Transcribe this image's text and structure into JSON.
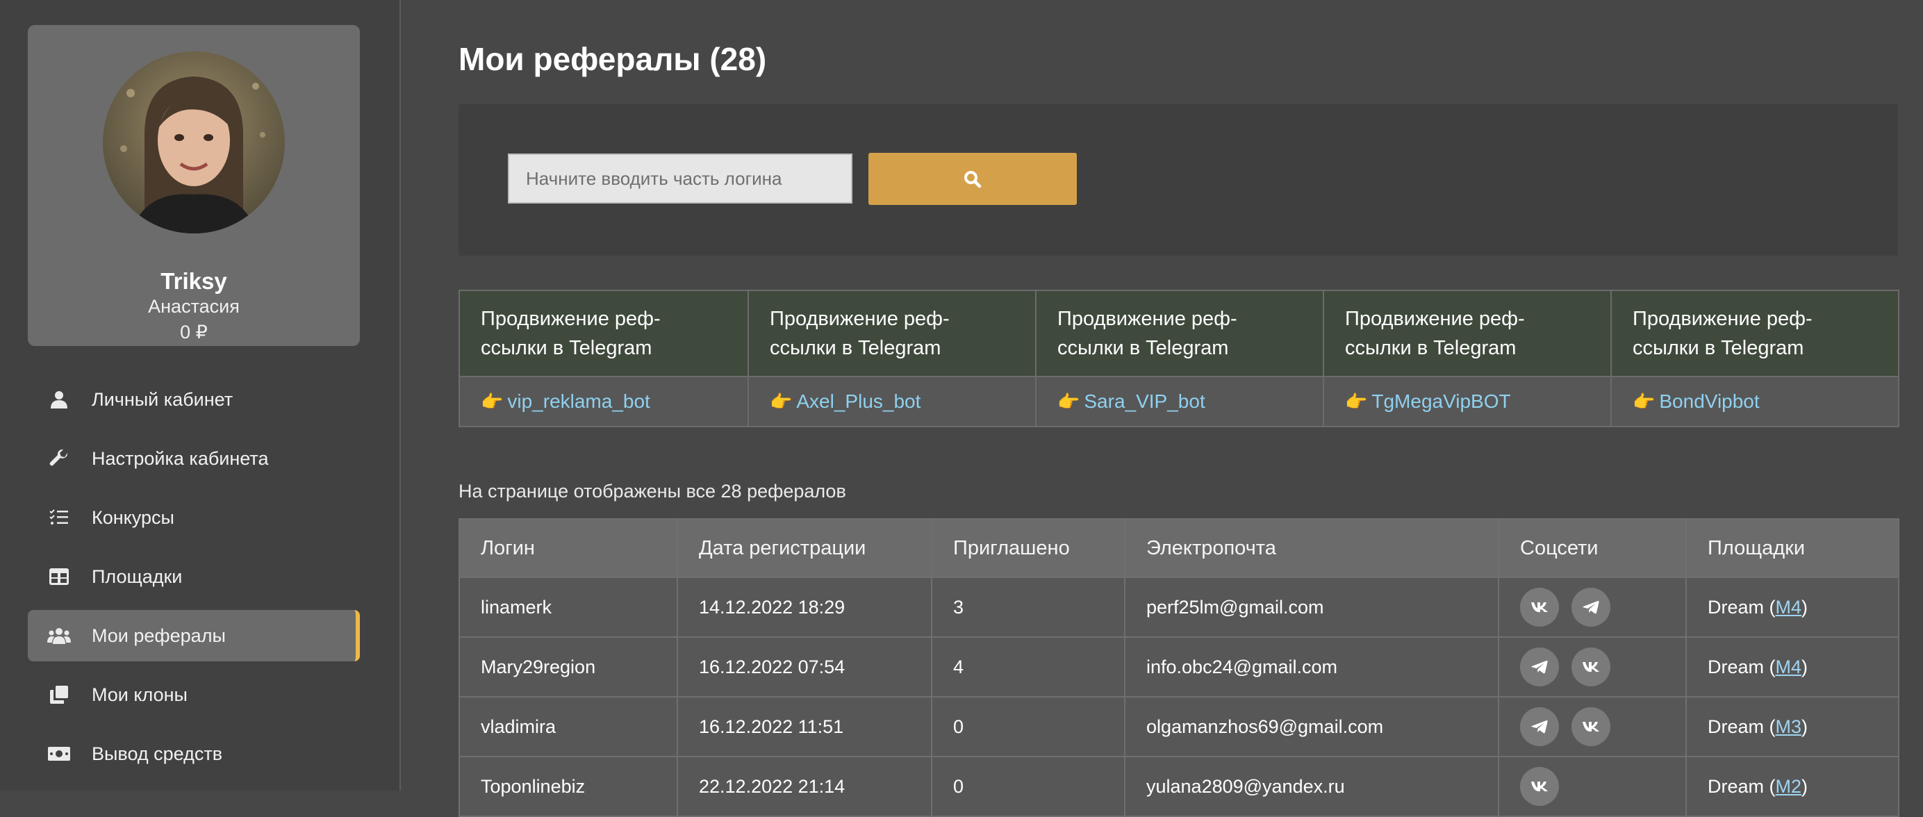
{
  "profile": {
    "login": "Triksy",
    "name": "Анастасия",
    "balance": "0 ₽"
  },
  "menu": [
    {
      "label": "Личный кабинет",
      "icon": "user-icon",
      "active": false
    },
    {
      "label": "Настройка кабинета",
      "icon": "wrench-icon",
      "active": false
    },
    {
      "label": "Конкурсы",
      "icon": "list-check-icon",
      "active": false
    },
    {
      "label": "Площадки",
      "icon": "table-icon",
      "active": false
    },
    {
      "label": "Мои рефералы",
      "icon": "users-icon",
      "active": true
    },
    {
      "label": "Мои клоны",
      "icon": "copy-icon",
      "active": false
    },
    {
      "label": "Вывод средств",
      "icon": "money-icon",
      "active": false
    }
  ],
  "page": {
    "title": "Мои рефералы (28)"
  },
  "search": {
    "placeholder": "Начните вводить часть логина",
    "button_icon": "search-icon"
  },
  "bots": [
    {
      "title": "Продвижение реф-ссылки в Telegram",
      "bot": "vip_reklama_bot"
    },
    {
      "title": "Продвижение реф-ссылки в Telegram",
      "bot": "Axel_Plus_bot"
    },
    {
      "title": "Продвижение реф-ссылки в Telegram",
      "bot": "Sara_VIP_bot"
    },
    {
      "title": "Продвижение реф-ссылки в Telegram",
      "bot": "TgMegaVipBOT"
    },
    {
      "title": "Продвижение реф-ссылки в Telegram",
      "bot": "BondVipbot"
    }
  ],
  "info": "На странице отображены все 28 рефералов",
  "table": {
    "headers": [
      "Логин",
      "Дата регистрации",
      "Приглашено",
      "Электропочта",
      "Соцсети",
      "Площадки"
    ],
    "rows": [
      {
        "login": "linamerk",
        "date": "14.12.2022 18:29",
        "invited": "3",
        "email": "perf25lm@gmail.com",
        "socials": [
          "vk",
          "telegram"
        ],
        "platform": "Dream",
        "platform_link": "M4"
      },
      {
        "login": "Mary29region",
        "date": "16.12.2022 07:54",
        "invited": "4",
        "email": "info.obc24@gmail.com",
        "socials": [
          "telegram",
          "vk"
        ],
        "platform": "Dream",
        "platform_link": "M4"
      },
      {
        "login": "vladimira",
        "date": "16.12.2022 11:51",
        "invited": "0",
        "email": "olgamanzhos69@gmail.com",
        "socials": [
          "telegram",
          "vk"
        ],
        "platform": "Dream",
        "platform_link": "M3"
      },
      {
        "login": "Toponlinebiz",
        "date": "22.12.2022 21:14",
        "invited": "0",
        "email": "yulana2809@yandex.ru",
        "socials": [
          "vk"
        ],
        "platform": "Dream",
        "platform_link": "M2"
      }
    ]
  },
  "colors": {
    "accent": "#d4a14a",
    "active_border": "#f0b94a",
    "link": "#8fd1f0",
    "header_green": "#3f4a3c"
  }
}
